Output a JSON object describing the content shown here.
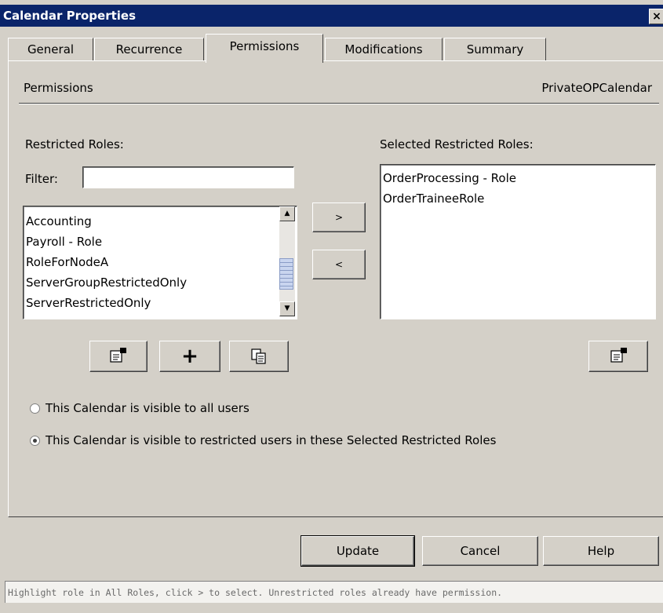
{
  "window": {
    "title": "Calendar Properties",
    "close_glyph": "×"
  },
  "tabs": [
    {
      "label": "General",
      "active": false
    },
    {
      "label": "Recurrence",
      "active": false
    },
    {
      "label": "Permissions",
      "active": true
    },
    {
      "label": "Modifications",
      "active": false
    },
    {
      "label": "Summary",
      "active": false
    }
  ],
  "header": {
    "section": "Permissions",
    "calendar_name": "PrivateOPCalendar"
  },
  "restricted": {
    "label": "Restricted Roles:",
    "filter_label": "Filter:",
    "filter_value": "",
    "roles": [
      "Accounting",
      "Payroll - Role",
      "RoleForNodeA",
      "ServerGroupRestrictedOnly",
      "ServerRestrictedOnly"
    ]
  },
  "selected": {
    "label": "Selected Restricted Roles:",
    "roles": [
      "OrderProcessing - Role",
      "OrderTraineeRole"
    ]
  },
  "move": {
    "add_label": ">",
    "remove_label": "<"
  },
  "tools": {
    "new_glyph": "+"
  },
  "visibility": {
    "all_label": "This Calendar is visible to all users",
    "restricted_label": "This Calendar is visible to restricted users in these Selected Restricted Roles",
    "selected_option": "restricted"
  },
  "buttons": {
    "update": "Update",
    "cancel": "Cancel",
    "help": "Help"
  },
  "status": "Highlight role in All Roles, click > to select. Unrestricted roles already have permission.",
  "colors": {
    "titlebar": "#0a246a",
    "dialog_bg": "#d4d0c8",
    "status_text": "#6a6a6a"
  },
  "icons": [
    "properties-icon",
    "add-icon",
    "copy-icon",
    "scroll-up-icon",
    "scroll-down-icon"
  ]
}
